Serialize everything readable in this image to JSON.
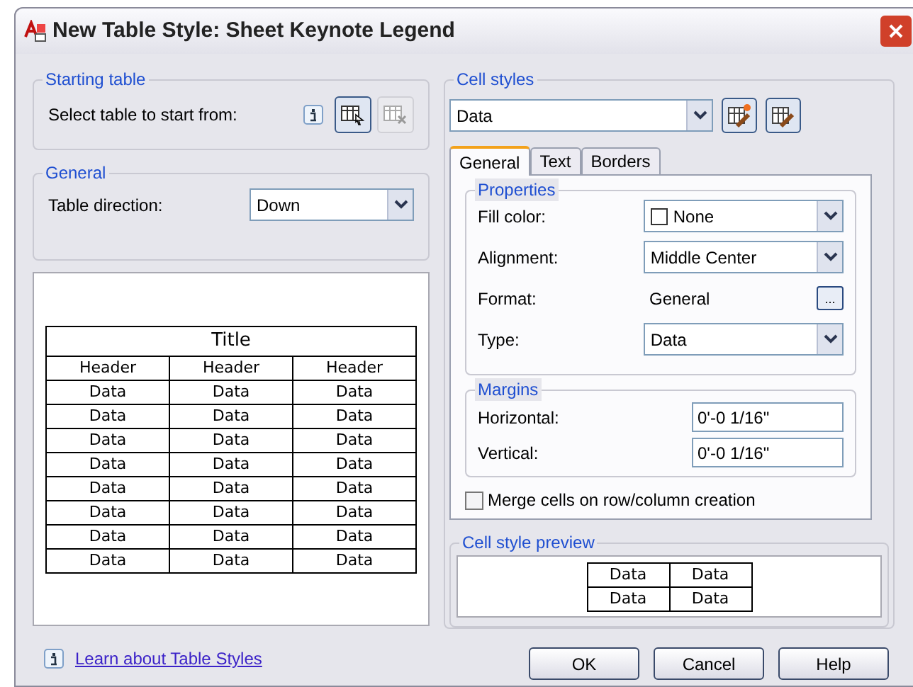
{
  "window": {
    "title": "New Table Style: Sheet Keynote Legend"
  },
  "starting_table": {
    "title": "Starting table",
    "label": "Select table to start from:"
  },
  "general": {
    "title": "General",
    "label": "Table direction:",
    "value": "Down"
  },
  "preview_table": {
    "title": "Title",
    "headers": [
      "Header",
      "Header",
      "Header"
    ],
    "rows": [
      [
        "Data",
        "Data",
        "Data"
      ],
      [
        "Data",
        "Data",
        "Data"
      ],
      [
        "Data",
        "Data",
        "Data"
      ],
      [
        "Data",
        "Data",
        "Data"
      ],
      [
        "Data",
        "Data",
        "Data"
      ],
      [
        "Data",
        "Data",
        "Data"
      ],
      [
        "Data",
        "Data",
        "Data"
      ],
      [
        "Data",
        "Data",
        "Data"
      ]
    ]
  },
  "learn_link": "Learn about Table Styles",
  "cell_styles": {
    "title": "Cell styles",
    "value": "Data",
    "tabs": [
      {
        "label": "General",
        "selected": true
      },
      {
        "label": "Text",
        "selected": false
      },
      {
        "label": "Borders",
        "selected": false
      }
    ],
    "properties": {
      "title": "Properties",
      "rows": [
        {
          "kind": "dropdown",
          "label": "Fill color:",
          "value": "None",
          "swatch": true
        },
        {
          "kind": "dropdown",
          "label": "Alignment:",
          "value": "Middle Center",
          "swatch": false
        },
        {
          "kind": "browse",
          "label": "Format:",
          "value": "General",
          "button": "..."
        },
        {
          "kind": "dropdown",
          "label": "Type:",
          "value": "Data",
          "swatch": false
        }
      ]
    },
    "margins": {
      "title": "Margins",
      "rows": [
        {
          "label": "Horizontal:",
          "value": "0'-0 1/16\""
        },
        {
          "label": "Vertical:",
          "value": "0'-0 1/16\""
        }
      ]
    },
    "merge": {
      "label": "Merge cells on row/column creation",
      "checked": false
    },
    "preview": {
      "title": "Cell style preview",
      "rows": [
        [
          "Data",
          "Data"
        ],
        [
          "Data",
          "Data"
        ]
      ]
    }
  },
  "buttons": [
    "OK",
    "Cancel",
    "Help"
  ]
}
